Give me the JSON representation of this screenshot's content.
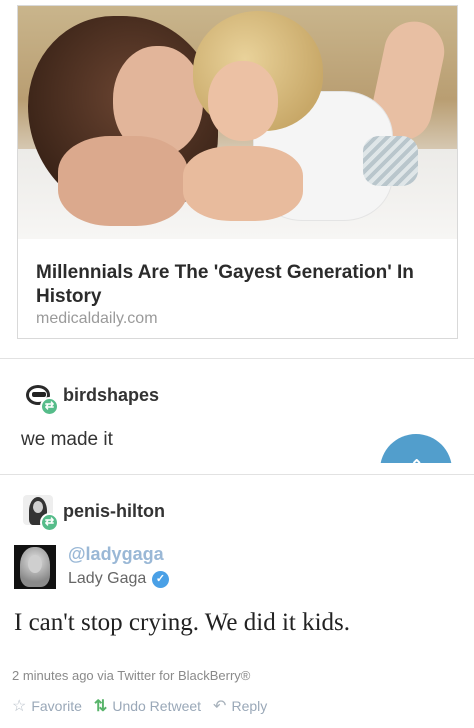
{
  "link_card": {
    "title": "Millennials Are The 'Gayest Generation' In History",
    "domain": "medicaldaily.com"
  },
  "reblogs": [
    {
      "username": "birdshapes",
      "text": "we made it"
    },
    {
      "username": "penis-hilton"
    }
  ],
  "tweet": {
    "handle": "@ladygaga",
    "name": "Lady Gaga",
    "text": "I can't stop crying. We did it kids.",
    "meta": "2 minutes ago via Twitter for BlackBerry®",
    "actions": {
      "favorite": "Favorite",
      "undo_retweet": "Undo Retweet",
      "reply": "Reply"
    }
  },
  "colors": {
    "reblog_badge": "#56bc8a",
    "fab": "#529ecc",
    "twitter_blue": "#4aa0e6"
  },
  "icons": {
    "reblog": "reblog-icon",
    "verified": "verified-check-icon",
    "favorite": "star-icon",
    "retweet": "retweet-icon",
    "reply": "reply-icon"
  }
}
